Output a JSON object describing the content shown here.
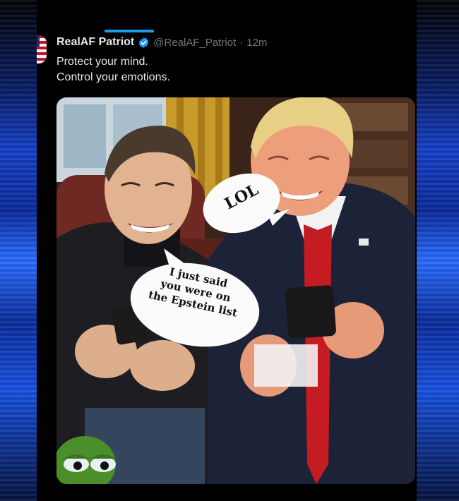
{
  "post": {
    "display_name": "RealAF Patriot",
    "handle": "@RealAF_Patriot",
    "separator": "·",
    "time": "12m",
    "text_lines": [
      "Protect your mind.",
      "Control your emotions."
    ]
  },
  "media": {
    "bubble_lol": "LOL",
    "bubble_epstein_lines": [
      "I just said",
      "you were on",
      "the Epstein list"
    ]
  },
  "icons": {
    "verified": "verified-badge-icon",
    "avatar": "flag-avatar"
  },
  "colors": {
    "accent": "#1d9bf0",
    "text_primary": "#e7e9ea",
    "text_secondary": "#71767b",
    "background": "#000000"
  }
}
